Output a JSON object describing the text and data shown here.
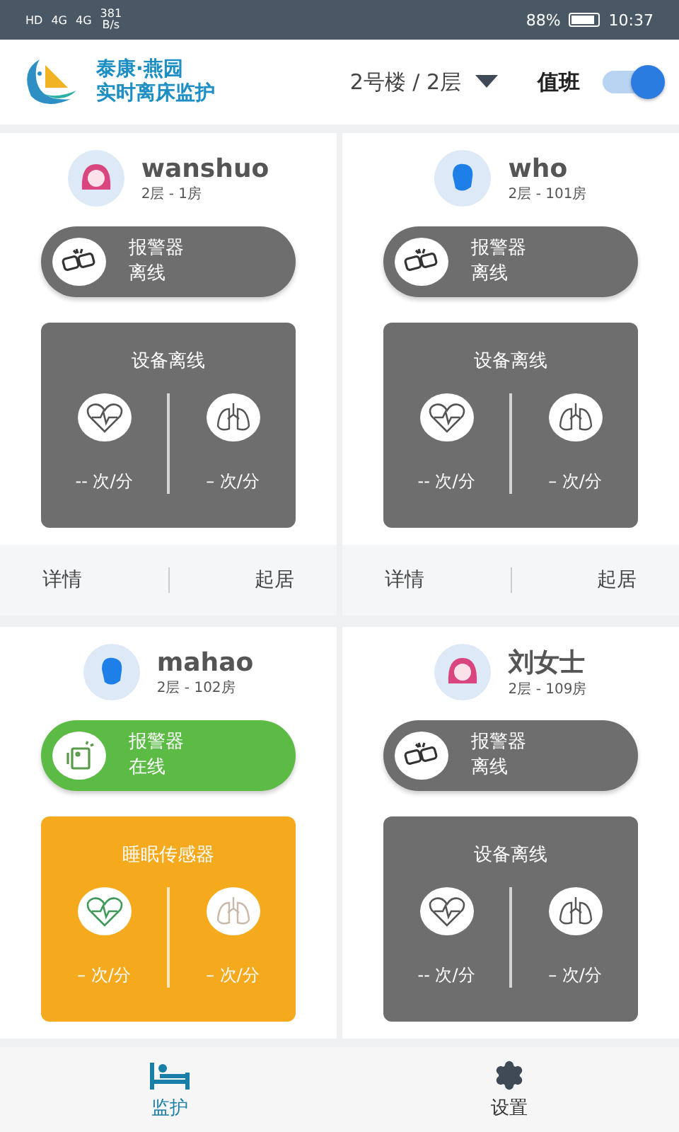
{
  "status_bar": {
    "left": [
      "HD",
      "4G",
      "4G"
    ],
    "speed": "381",
    "speed_unit": "B/s",
    "battery": "88%",
    "time": "10:37"
  },
  "header": {
    "brand_line1": "泰康·燕园",
    "brand_line2": "实时离床监护",
    "location": "2号楼 / 2层",
    "duty_label": "值班",
    "duty_on": true
  },
  "residents": [
    {
      "name": "wanshuo",
      "room": "2层 - 1房",
      "kind": "female",
      "alarm": {
        "label": "报警器",
        "status": "离线",
        "online": false
      },
      "sensor": {
        "title": "设备离线",
        "online": false,
        "heart_rate": "-- 次/分",
        "breath_rate": "– 次/分"
      },
      "actions": [
        "详情",
        "起居"
      ]
    },
    {
      "name": "who",
      "room": "2层 - 101房",
      "kind": "male",
      "alarm": {
        "label": "报警器",
        "status": "离线",
        "online": false
      },
      "sensor": {
        "title": "设备离线",
        "online": false,
        "heart_rate": "-- 次/分",
        "breath_rate": "– 次/分"
      },
      "actions": [
        "详情",
        "起居"
      ]
    },
    {
      "name": "mahao",
      "room": "2层 - 102房",
      "kind": "male",
      "alarm": {
        "label": "报警器",
        "status": "在线",
        "online": true
      },
      "sensor": {
        "title": "睡眠传感器",
        "online": true,
        "heart_rate": "– 次/分",
        "breath_rate": "– 次/分"
      }
    },
    {
      "name": "刘女士",
      "room": "2层 - 109房",
      "kind": "female",
      "alarm": {
        "label": "报警器",
        "status": "离线",
        "online": false
      },
      "sensor": {
        "title": "设备离线",
        "online": false,
        "heart_rate": "-- 次/分",
        "breath_rate": "– 次/分"
      }
    }
  ],
  "tabs": [
    {
      "label": "监护",
      "kind": "bed",
      "selected": true
    },
    {
      "label": "设置",
      "kind": "gear",
      "selected": false
    }
  ]
}
